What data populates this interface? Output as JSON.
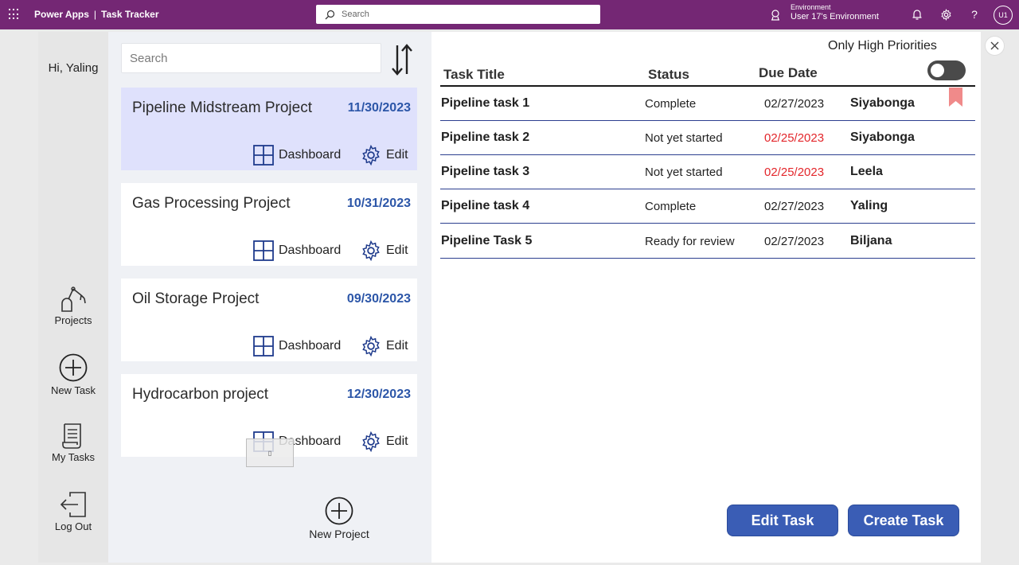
{
  "topbar": {
    "app_name": "Power Apps",
    "separator": "|",
    "page_name": "Task Tracker",
    "search_placeholder": "Search",
    "environment_label": "Environment",
    "environment_name": "User 17's Environment",
    "help_glyph": "?",
    "user_initials": "U1",
    "icons": [
      "waffle-icon",
      "search-icon",
      "environment-icon",
      "bell-icon",
      "gear-icon",
      "help-icon"
    ]
  },
  "nav": {
    "greeting": "Hi, Yaling",
    "items": [
      {
        "label": "Projects",
        "icon": "robot-arm-icon"
      },
      {
        "label": "New Task",
        "icon": "plus-circle-icon"
      },
      {
        "label": "My Tasks",
        "icon": "document-list-icon"
      },
      {
        "label": "Log Out",
        "icon": "sign-out-icon"
      }
    ]
  },
  "projects": {
    "search_placeholder": "Search",
    "dashboard_label": "Dashboard",
    "edit_label": "Edit",
    "new_project_label": "New Project",
    "list": [
      {
        "name": "Pipeline Midstream Project",
        "date": "11/30/2023",
        "selected": true
      },
      {
        "name": "Gas Processing Project",
        "date": "10/31/2023",
        "selected": false
      },
      {
        "name": "Oil Storage Project",
        "date": "09/30/2023",
        "selected": false
      },
      {
        "name": "Hydrocarbon project",
        "date": "12/30/2023",
        "selected": false
      }
    ]
  },
  "tasks": {
    "filter_label": "Only High Priorities",
    "filter_on": false,
    "headers": {
      "title": "Task Title",
      "status": "Status",
      "due": "Due Date"
    },
    "rows": [
      {
        "title": "Pipeline task 1",
        "status": "Complete",
        "due": "02/27/2023",
        "overdue": false,
        "owner": "Siyabonga"
      },
      {
        "title": "Pipeline task 2",
        "status": "Not yet started",
        "due": "02/25/2023",
        "overdue": true,
        "owner": "Siyabonga"
      },
      {
        "title": "Pipeline task 3",
        "status": "Not yet started",
        "due": "02/25/2023",
        "overdue": true,
        "owner": "Leela"
      },
      {
        "title": "Pipeline task 4",
        "status": "Complete",
        "due": "02/27/2023",
        "overdue": false,
        "owner": "Yaling"
      },
      {
        "title": "Pipeline Task 5",
        "status": "Ready for review",
        "due": "02/27/2023",
        "overdue": false,
        "owner": "Biljana"
      }
    ],
    "edit_task_label": "Edit Task",
    "create_task_label": "Create Task"
  },
  "colors": {
    "topbar": "#742774",
    "accent_blue": "#3a5db5",
    "date_blue": "#2c56a8",
    "overdue_red": "#e3262b",
    "selected_card": "#dfe1fc",
    "bookmark": "#f08a8a"
  }
}
